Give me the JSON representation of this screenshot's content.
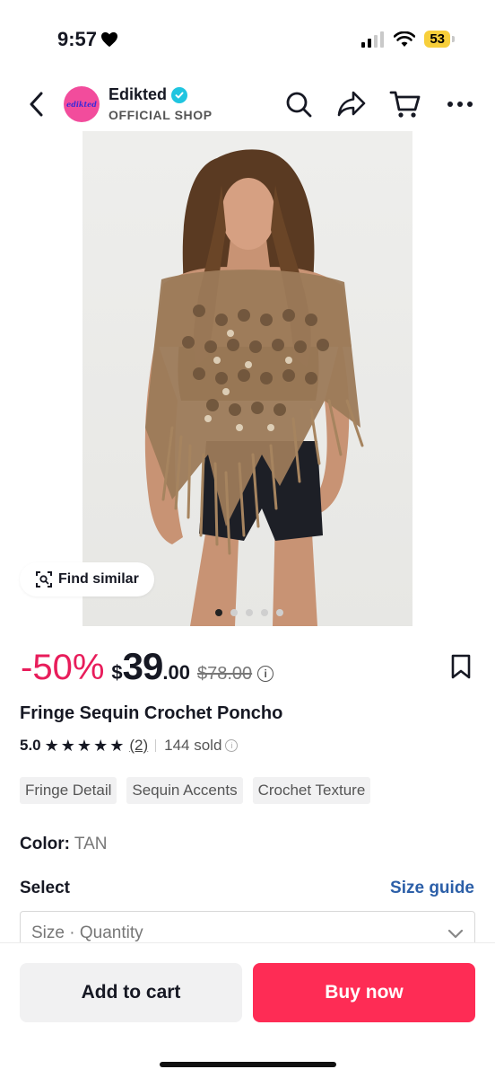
{
  "status_bar": {
    "time": "9:57",
    "battery": "53",
    "battery_color": "#f7cf3b"
  },
  "nav": {
    "back_icon": "chevron-left-icon",
    "shop_logo_text": "edikted",
    "shop_name": "Edikted",
    "shop_sub": "OFFICIAL SHOP",
    "icons": [
      "search-icon",
      "share-icon",
      "cart-icon",
      "more-icon"
    ]
  },
  "image": {
    "find_similar_label": "Find similar",
    "carousel_count": 5,
    "carousel_active": 0
  },
  "price": {
    "discount": "-50%",
    "currency": "$",
    "whole": "39",
    "decimal": ".00",
    "original": "$78.00",
    "accent_color": "#e81d5b"
  },
  "product": {
    "title": "Fringe Sequin Crochet Poncho",
    "rating": "5.0",
    "stars": 5,
    "review_count": "(2)",
    "sold": "144 sold",
    "tags": [
      "Fringe Detail",
      "Sequin Accents",
      "Crochet Texture"
    ],
    "color_label": "Color:",
    "color_value": "TAN"
  },
  "selection": {
    "label": "Select",
    "size_guide": "Size guide",
    "dropdown_placeholder": "Size · Quantity"
  },
  "actions": {
    "add_to_cart": "Add to cart",
    "buy_now": "Buy now",
    "buy_color": "#fe2c55"
  }
}
